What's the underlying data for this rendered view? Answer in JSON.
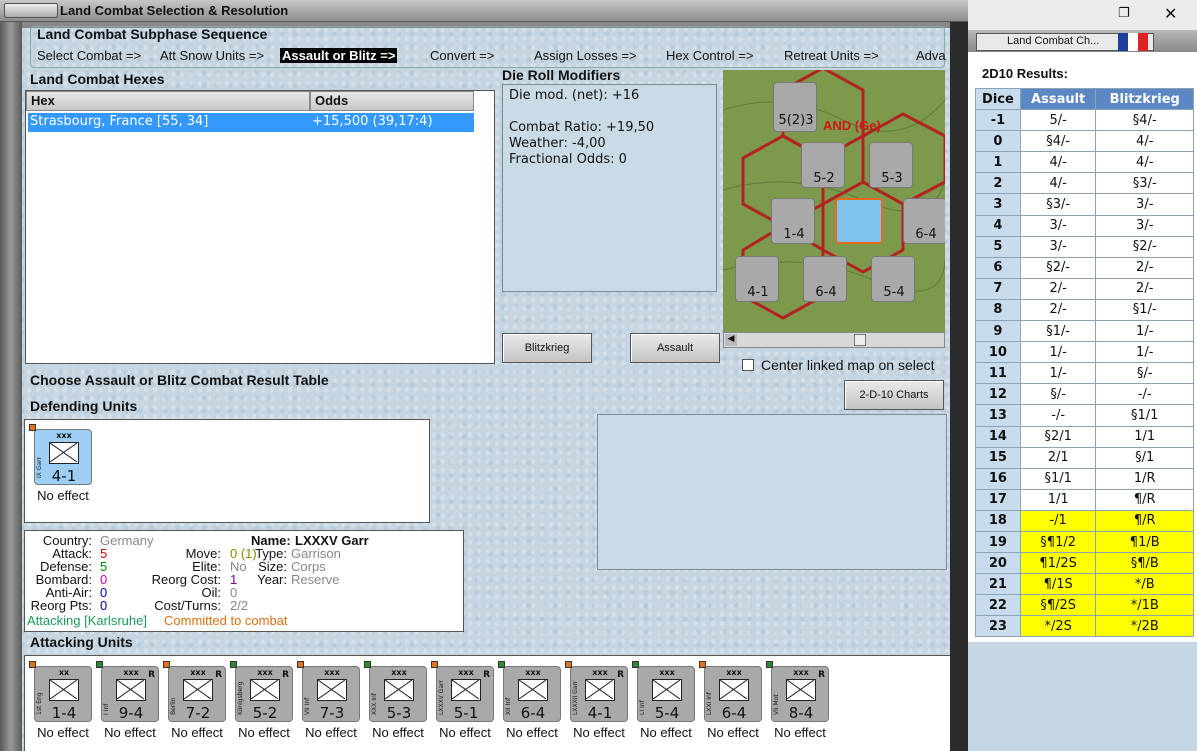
{
  "window": {
    "title": "Land Combat Selection & Resolution"
  },
  "sequence": {
    "title": "Land Combat Subphase Sequence",
    "steps": [
      "Select Combat =>",
      "Att Snow Units =>",
      "Assault or Blitz =>",
      "Convert =>",
      "Assign Losses =>",
      "Hex Control =>",
      "Retreat Units =>",
      "Adva"
    ],
    "active_index": 2
  },
  "hexes": {
    "title": "Land Combat Hexes",
    "col_hex": "Hex",
    "col_odds": "Odds",
    "rows": [
      {
        "hex": "Strasbourg, France [55, 34]",
        "odds": "+15,500 (39,17:4)"
      }
    ]
  },
  "modifiers": {
    "title": "Die Roll Modifiers",
    "net": "Die mod. (net): +16",
    "ratio": "Combat Ratio: +19,50",
    "weather": "Weather: -4,00",
    "fractional": "Fractional Odds: 0"
  },
  "buttons": {
    "blitz": "Blitzkrieg",
    "assault": "Assault",
    "charts": "2-D-10 Charts",
    "center": "Center linked map on select"
  },
  "prompt": "Choose Assault or Blitz Combat Result Table",
  "defending": {
    "title": "Defending Units",
    "units": [
      {
        "name": "IX Garr",
        "size": "xxx",
        "str": "4-1",
        "effect": "No effect"
      }
    ]
  },
  "info": {
    "country_l": "Country:",
    "country": "Germany",
    "attack_l": "Attack:",
    "attack": "5",
    "defense_l": "Defense:",
    "defense": "5",
    "bombard_l": "Bombard:",
    "bombard": "0",
    "antiair_l": "Anti-Air:",
    "antiair": "0",
    "reorgpts_l": "Reorg Pts:",
    "reorgpts": "0",
    "name_l": "Name:",
    "name": "LXXXV Garr",
    "move_l": "Move:",
    "move": "0 (1)",
    "elite_l": "Elite:",
    "elite": "No",
    "reorgcost_l": "Reorg Cost:",
    "reorgcost": "1",
    "oil_l": "Oil:",
    "oil": "0",
    "costturns_l": "Cost/Turns:",
    "costturns": "2/2",
    "type_l": "Type:",
    "type": "Garrison",
    "size_l": "Size:",
    "size": "Corps",
    "year_l": "Year:",
    "year": "Reserve",
    "attacking": "Attacking [Karlsruhe]",
    "committed": "Committed to combat"
  },
  "attacking": {
    "title": "Attacking Units",
    "units": [
      {
        "name": "1st Eng",
        "size": "xx",
        "str": "1-4",
        "effect": "No effect",
        "R": ""
      },
      {
        "name": "I Inf",
        "size": "xxx",
        "str": "9-4",
        "effect": "No effect",
        "R": "R"
      },
      {
        "name": "Berlin",
        "size": "xxx",
        "str": "7-2",
        "effect": "No effect",
        "R": "R"
      },
      {
        "name": "Königsberg",
        "size": "xxx",
        "str": "5-2",
        "effect": "No effect",
        "R": "R"
      },
      {
        "name": "VII Inf",
        "size": "xxx",
        "str": "7-3",
        "effect": "No effect",
        "R": ""
      },
      {
        "name": "XXX Inf",
        "size": "xxx",
        "str": "5-3",
        "effect": "No effect",
        "R": ""
      },
      {
        "name": "LXXXV Garr",
        "size": "xxx",
        "str": "5-1",
        "effect": "No effect",
        "R": "R"
      },
      {
        "name": "XII Inf",
        "size": "xxx",
        "str": "6-4",
        "effect": "No effect",
        "R": ""
      },
      {
        "name": "LXXXII Garr",
        "size": "xxx",
        "str": "4-1",
        "effect": "No effect",
        "R": "R"
      },
      {
        "name": "LI Inf",
        "size": "xxx",
        "str": "5-4",
        "effect": "No effect",
        "R": ""
      },
      {
        "name": "LXXI Inf",
        "size": "xxx",
        "str": "6-4",
        "effect": "No effect",
        "R": ""
      },
      {
        "name": "VII Mot",
        "size": "xxx",
        "str": "8-4",
        "effect": "No effect",
        "R": "R"
      }
    ]
  },
  "map": {
    "label": "AND (Ge)",
    "counters": [
      {
        "str": "5(2)3"
      },
      {
        "str": "5-2"
      },
      {
        "str": "5-3"
      },
      {
        "str": "1-4"
      },
      {
        "str": "6-4"
      },
      {
        "str": "4-1"
      },
      {
        "str": "6-4"
      },
      {
        "str": "5-4"
      }
    ]
  },
  "side": {
    "tab": "Land Combat Ch...",
    "title": "2D10 Results:",
    "col_dice": "Dice",
    "col_assault": "Assault",
    "col_blitz": "Blitzkrieg",
    "rows": [
      {
        "d": "-1",
        "a": "5/-",
        "b": "§4/-"
      },
      {
        "d": "0",
        "a": "§4/-",
        "b": "4/-"
      },
      {
        "d": "1",
        "a": "4/-",
        "b": "4/-"
      },
      {
        "d": "2",
        "a": "4/-",
        "b": "§3/-"
      },
      {
        "d": "3",
        "a": "§3/-",
        "b": "3/-"
      },
      {
        "d": "4",
        "a": "3/-",
        "b": "3/-"
      },
      {
        "d": "5",
        "a": "3/-",
        "b": "§2/-"
      },
      {
        "d": "6",
        "a": "§2/-",
        "b": "2/-"
      },
      {
        "d": "7",
        "a": "2/-",
        "b": "2/-"
      },
      {
        "d": "8",
        "a": "2/-",
        "b": "§1/-"
      },
      {
        "d": "9",
        "a": "§1/-",
        "b": "1/-"
      },
      {
        "d": "10",
        "a": "1/-",
        "b": "1/-"
      },
      {
        "d": "11",
        "a": "1/-",
        "b": "§/-"
      },
      {
        "d": "12",
        "a": "§/-",
        "b": "-/-"
      },
      {
        "d": "13",
        "a": "-/-",
        "b": "§1/1"
      },
      {
        "d": "14",
        "a": "§2/1",
        "b": "1/1"
      },
      {
        "d": "15",
        "a": "2/1",
        "b": "§/1"
      },
      {
        "d": "16",
        "a": "§1/1",
        "b": "1/R"
      },
      {
        "d": "17",
        "a": "1/1",
        "b": "¶/R"
      },
      {
        "d": "18",
        "a": "-/1",
        "b": "¶/R"
      },
      {
        "d": "19",
        "a": "§¶1/2",
        "b": "¶1/B"
      },
      {
        "d": "20",
        "a": "¶1/2S",
        "b": "§¶/B"
      },
      {
        "d": "21",
        "a": "¶/1S",
        "b": "*/B"
      },
      {
        "d": "22",
        "a": "§¶/2S",
        "b": "*/1B"
      },
      {
        "d": "23",
        "a": "*/2S",
        "b": "*/2B"
      }
    ],
    "highlight_from": 18
  },
  "colors": {
    "highlight": "#3399ff",
    "yellow": "#ffff00",
    "header": "#5b87c5"
  }
}
